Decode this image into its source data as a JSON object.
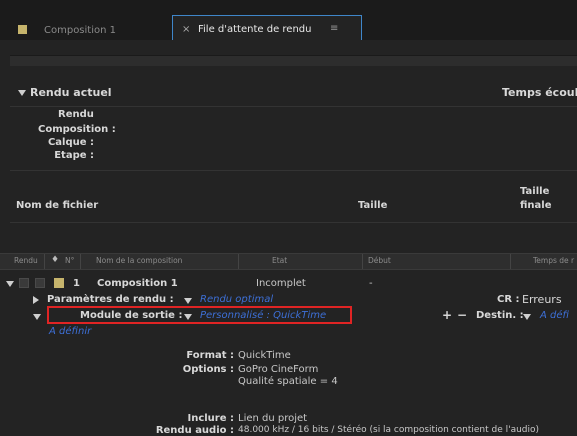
{
  "tabs": [
    {
      "label": "Composition 1",
      "active": false
    },
    {
      "close": "×",
      "label": "File d'attente de rendu",
      "menu": "≡",
      "active": true
    }
  ],
  "current_render": {
    "title": "Rendu actuel",
    "elapsed_label": "Temps écoul",
    "rendu": "Rendu",
    "composition": "Composition :",
    "layer": "Calque :",
    "step": "Etape :"
  },
  "file_info": {
    "filename": "Nom de fichier",
    "size": "Taille",
    "final_size": "Taille",
    "final_size2": "finale"
  },
  "columns": [
    "Rendu",
    "N°",
    "Nom de la composition",
    "Etat",
    "Début",
    "Temps de r"
  ],
  "queue_item": {
    "number": "1",
    "name": "Composition 1",
    "status": "Incomplet",
    "start": "-",
    "render_settings_label": "Paramètres de rendu :",
    "render_settings_value": "Rendu optimal",
    "cr_label": "CR :",
    "cr_value": "Erreurs",
    "output_module_label": "Module de sortie :",
    "output_module_value": "Personnalisé : QuickTime",
    "plus": "+",
    "minus": "−",
    "dest_label": "Destin. :",
    "dest_value": "A défi",
    "undefined": "A définir",
    "format_label": "Format :",
    "format_value": "QuickTime",
    "options_label": "Options :",
    "options_value1": "GoPro CineForm",
    "options_value2": "Qualité spatiale = 4",
    "include_label": "Inclure :",
    "include_value": "Lien du projet",
    "audio_label": "Rendu audio :",
    "audio_value": "48.000 kHz / 16 bits / Stéréo (si la composition contient de l'audio)"
  },
  "colors": {
    "accent": "#3f86c9",
    "highlight": "#e02424",
    "label": "#c6b46c",
    "link": "#3d6fd6"
  }
}
